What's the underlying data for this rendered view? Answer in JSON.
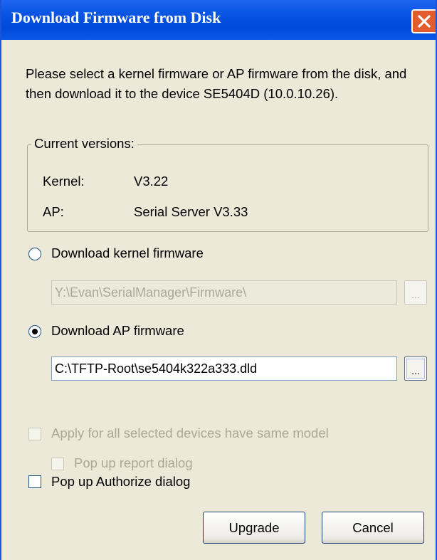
{
  "window": {
    "title": "Download Firmware from Disk",
    "close_icon": "close-icon"
  },
  "description": "Please select a kernel firmware or AP firmware from the disk, and then download it to the device SE5404D (10.0.10.26).",
  "current_versions": {
    "legend": "Current versions:",
    "kernel_label": "Kernel:",
    "kernel_value": "V3.22",
    "ap_label": "AP:",
    "ap_value": "Serial Server V3.33"
  },
  "kernel_option": {
    "label": "Download kernel firmware",
    "selected": false,
    "path": "Y:\\Evan\\SerialManager\\Firmware\\",
    "browse_label": "..."
  },
  "ap_option": {
    "label": "Download AP firmware",
    "selected": true,
    "path": "C:\\TFTP-Root\\se5404k322a333.dld",
    "browse_label": "..."
  },
  "options": {
    "apply_all_label": "Apply for all selected devices have same model",
    "popup_report_label": "Pop up report dialog",
    "popup_authorize_label": "Pop up Authorize dialog"
  },
  "buttons": {
    "upgrade": "Upgrade",
    "cancel": "Cancel"
  },
  "colors": {
    "titlebar": "#0a54e3",
    "close": "#e25c2e",
    "dialog_bg": "#ece9d8"
  }
}
